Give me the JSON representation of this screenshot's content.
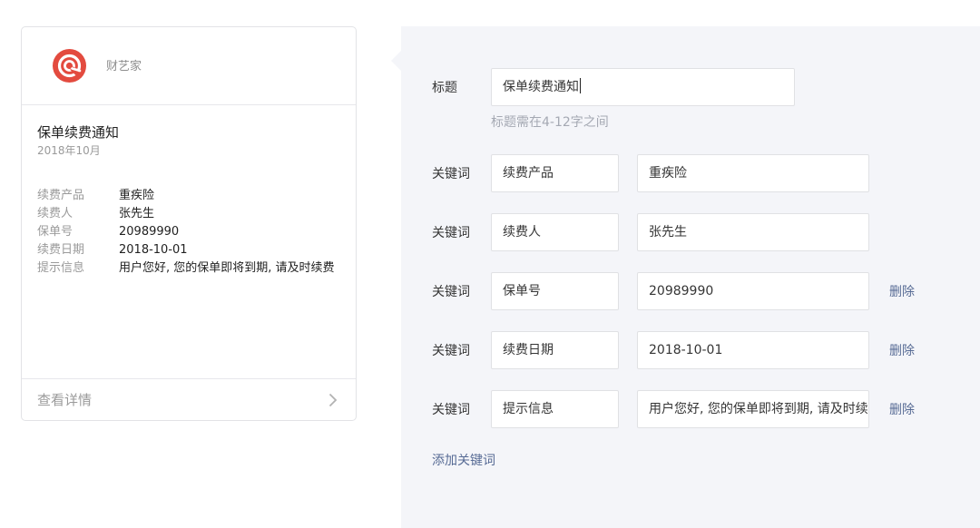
{
  "preview": {
    "account_name": "财艺家",
    "title": "保单续费通知",
    "date": "2018年10月",
    "items": [
      {
        "key": "续费产品",
        "value": "重疾险"
      },
      {
        "key": "续费人",
        "value": "张先生"
      },
      {
        "key": "保单号",
        "value": "20989990"
      },
      {
        "key": "续费日期",
        "value": "2018-10-01"
      },
      {
        "key": "提示信息",
        "value": "用户您好, 您的保单即将到期, 请及时续费"
      }
    ],
    "detail_link": "查看详情"
  },
  "editor": {
    "title_label": "标题",
    "title_value": "保单续费通知",
    "title_hint": "标题需在4-12字之间",
    "keyword_label": "关键词",
    "delete_label": "删除",
    "keywords": [
      {
        "name": "续费产品",
        "value": "重疾险"
      },
      {
        "name": "续费人",
        "value": "张先生"
      },
      {
        "name": "保单号",
        "value": "20989990"
      },
      {
        "name": "续费日期",
        "value": "2018-10-01"
      },
      {
        "name": "提示信息",
        "value": "用户您好, 您的保单即将到期, 请及时续费"
      }
    ],
    "add_keyword_label": "添加关键词"
  },
  "colors": {
    "logo_red": "#e34b3f",
    "link_blue": "#576b95",
    "panel_bg": "#f4f5f9"
  },
  "icons": {
    "logo": "caiyijia-logo-icon",
    "footer_arrow": "chevron-right-icon"
  }
}
